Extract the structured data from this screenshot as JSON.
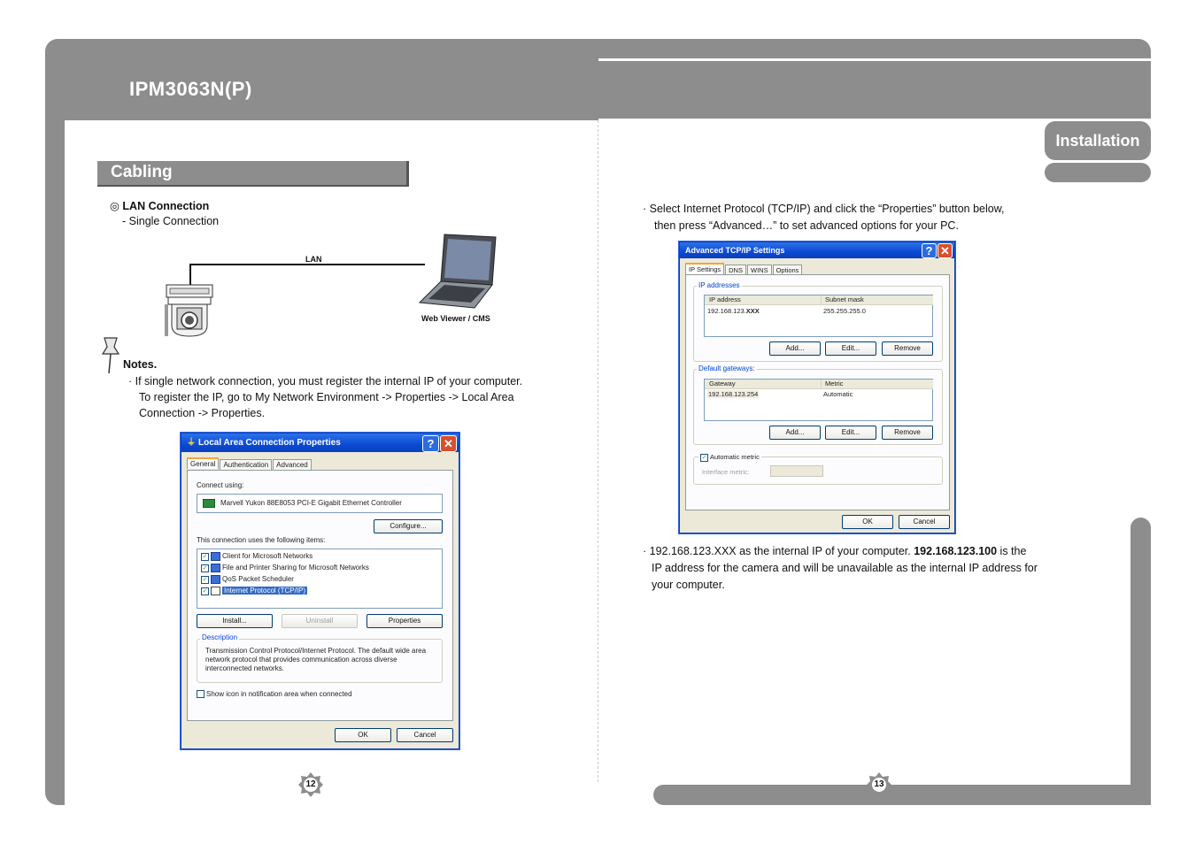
{
  "header": {
    "title": "IPM3063N(P)"
  },
  "tab": {
    "label": "Installation"
  },
  "section": {
    "title": "Cabling"
  },
  "lan": {
    "heading": "LAN Connection",
    "bullet": "◎",
    "sub": "- Single Connection",
    "cable_label": "LAN",
    "pc_label": "Web Viewer / CMS"
  },
  "notes": {
    "title": "Notes.",
    "line1": "·  If single network connection, you must register the internal IP of your computer.",
    "line2": "To register the IP, go to My Network Environment -> Properties -> Local Area",
    "line3": "Connection -> Properties."
  },
  "lac_dialog": {
    "title": "Local Area Connection Properties",
    "tabs": [
      "General",
      "Authentication",
      "Advanced"
    ],
    "connect_using": "Connect using:",
    "adapter": "Marvell Yukon 88E8053 PCI-E Gigabit Ethernet Controller",
    "configure": "Configure...",
    "items_label": "This connection uses the following items:",
    "items": [
      "Client for Microsoft Networks",
      "File and Printer Sharing for Microsoft Networks",
      "QoS Packet Scheduler",
      "Internet Protocol (TCP/IP)"
    ],
    "install": "Install...",
    "uninstall": "Uninstall",
    "properties": "Properties",
    "description_label": "Description",
    "description": "Transmission Control Protocol/Internet Protocol. The default wide area network protocol that provides communication across diverse interconnected networks.",
    "show_icon": "Show icon in notification area when connected",
    "ok": "OK",
    "cancel": "Cancel"
  },
  "right": {
    "para1_line1": "·  Select Internet Protocol (TCP/IP) and click the “Properties” button below,",
    "para1_line2": "then press “Advanced…” to set advanced options for your PC.",
    "para2_pre": "·  192.168.123.XXX as the internal IP of your computer. ",
    "para2_bold": "192.168.123.100",
    "para2_post": " is the",
    "para2_line2": "IP address for the camera and will be unavailable as the internal IP address for",
    "para2_line3": "your computer."
  },
  "adv_dialog": {
    "title": "Advanced TCP/IP Settings",
    "tabs": [
      "IP Settings",
      "DNS",
      "WINS",
      "Options"
    ],
    "ip_group": "IP addresses",
    "col_ip": "IP address",
    "col_mask": "Subnet mask",
    "ip_prefix": "192.168.123.",
    "ip_suffix": "XXX",
    "mask": "255.255.255.0",
    "add1": "Add...",
    "edit1": "Edit...",
    "remove1": "Remove",
    "gw_group": "Default gateways:",
    "col_gw": "Gateway",
    "col_metric": "Metric",
    "gw": "192.168.123.254",
    "metric": "Automatic",
    "add2": "Add...",
    "edit2": "Edit...",
    "remove2": "Remove",
    "auto_metric": "Automatic metric",
    "iface_metric": "Interface metric:",
    "ok": "OK",
    "cancel": "Cancel"
  },
  "pages": {
    "left": "12",
    "right": "13"
  }
}
